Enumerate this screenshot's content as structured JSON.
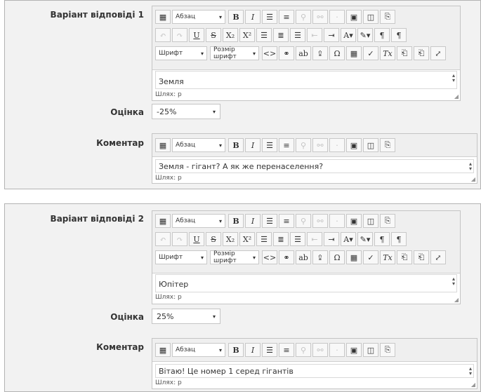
{
  "answers": [
    {
      "label": "Варіант відповіді 1",
      "text": "Земля",
      "grade_label": "Оцінка",
      "grade": "-25%",
      "feedback_label": "Коментар",
      "feedback": "Земля - гігант? А як же перенаселення?"
    },
    {
      "label": "Варіант відповіді 2",
      "text": "Юпітер",
      "grade_label": "Оцінка",
      "grade": "25%",
      "feedback_label": "Коментар",
      "feedback": "Вітаю! Це номер 1 серед гігантів"
    }
  ],
  "editor": {
    "format_select": "Абзац",
    "font_select": "Шрифт",
    "font_size_select": "Розмір шрифт",
    "path": "Шлях: p"
  }
}
